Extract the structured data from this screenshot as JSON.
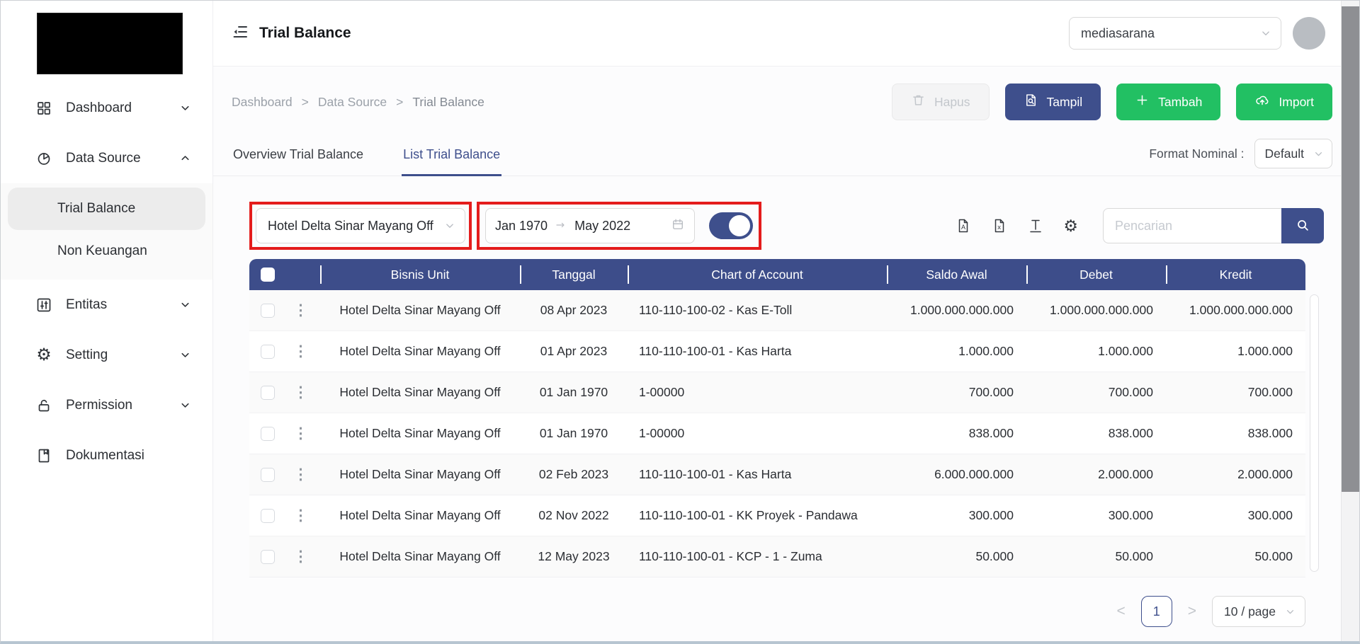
{
  "colors": {
    "indigo": "#3e4f8c",
    "table_header": "#3d4d8a",
    "green": "#22c063",
    "annotation_red": "#e41c1c"
  },
  "topbar": {
    "title": "Trial Balance",
    "workspace": "mediasarana"
  },
  "sidebar": {
    "items": [
      {
        "label": "Dashboard"
      },
      {
        "label": "Data Source"
      },
      {
        "label": "Entitas"
      },
      {
        "label": "Setting"
      },
      {
        "label": "Permission"
      },
      {
        "label": "Dokumentasi"
      }
    ],
    "submenu": [
      {
        "label": "Trial Balance"
      },
      {
        "label": "Non Keuangan"
      }
    ]
  },
  "breadcrumb": {
    "items": [
      "Dashboard",
      "Data Source",
      "Trial Balance"
    ],
    "separator": ">"
  },
  "toolbar": {
    "hapus": "Hapus",
    "tampil": "Tampil",
    "tambah": "Tambah",
    "import": "Import"
  },
  "tabs": {
    "overview": "Overview Trial Balance",
    "list": "List Trial Balance"
  },
  "format_nominal": {
    "label": "Format Nominal :",
    "value": "Default"
  },
  "filters": {
    "business_unit": "Hotel Delta Sinar Mayang Off",
    "date_start": "Jan 1970",
    "date_end": "May 2022",
    "toggle_on": true
  },
  "search": {
    "placeholder": "Pencarian"
  },
  "icons": {
    "kebab": "⋮",
    "gear": "⚙"
  },
  "table": {
    "columns": [
      "Bisnis Unit",
      "Tanggal",
      "Chart of Account",
      "Saldo Awal",
      "Debet",
      "Kredit"
    ],
    "rows": [
      {
        "unit": "Hotel Delta Sinar Mayang Off",
        "date": "08 Apr 2023",
        "coa": "110-110-100-02 - Kas E-Toll",
        "saldo": "1.000.000.000.000",
        "debet": "1.000.000.000.000",
        "kredit": "1.000.000.000.000"
      },
      {
        "unit": "Hotel Delta Sinar Mayang Off",
        "date": "01 Apr 2023",
        "coa": "110-110-100-01 - Kas Harta",
        "saldo": "1.000.000",
        "debet": "1.000.000",
        "kredit": "1.000.000"
      },
      {
        "unit": "Hotel Delta Sinar Mayang Off",
        "date": "01 Jan 1970",
        "coa": "1-00000",
        "saldo": "700.000",
        "debet": "700.000",
        "kredit": "700.000"
      },
      {
        "unit": "Hotel Delta Sinar Mayang Off",
        "date": "01 Jan 1970",
        "coa": "1-00000",
        "saldo": "838.000",
        "debet": "838.000",
        "kredit": "838.000"
      },
      {
        "unit": "Hotel Delta Sinar Mayang Off",
        "date": "02 Feb 2023",
        "coa": "110-110-100-01 - Kas Harta",
        "saldo": "6.000.000.000",
        "debet": "2.000.000",
        "kredit": "2.000.000"
      },
      {
        "unit": "Hotel Delta Sinar Mayang Off",
        "date": "02 Nov 2022",
        "coa": "110-110-100-01 - KK Proyek - Pandawa",
        "saldo": "300.000",
        "debet": "300.000",
        "kredit": "300.000"
      },
      {
        "unit": "Hotel Delta Sinar Mayang Off",
        "date": "12 May 2023",
        "coa": "110-110-100-01 - KCP - 1 - Zuma",
        "saldo": "50.000",
        "debet": "50.000",
        "kredit": "50.000"
      }
    ]
  },
  "pagination": {
    "prev": "<",
    "page": "1",
    "next": ">",
    "size": "10 / page"
  }
}
